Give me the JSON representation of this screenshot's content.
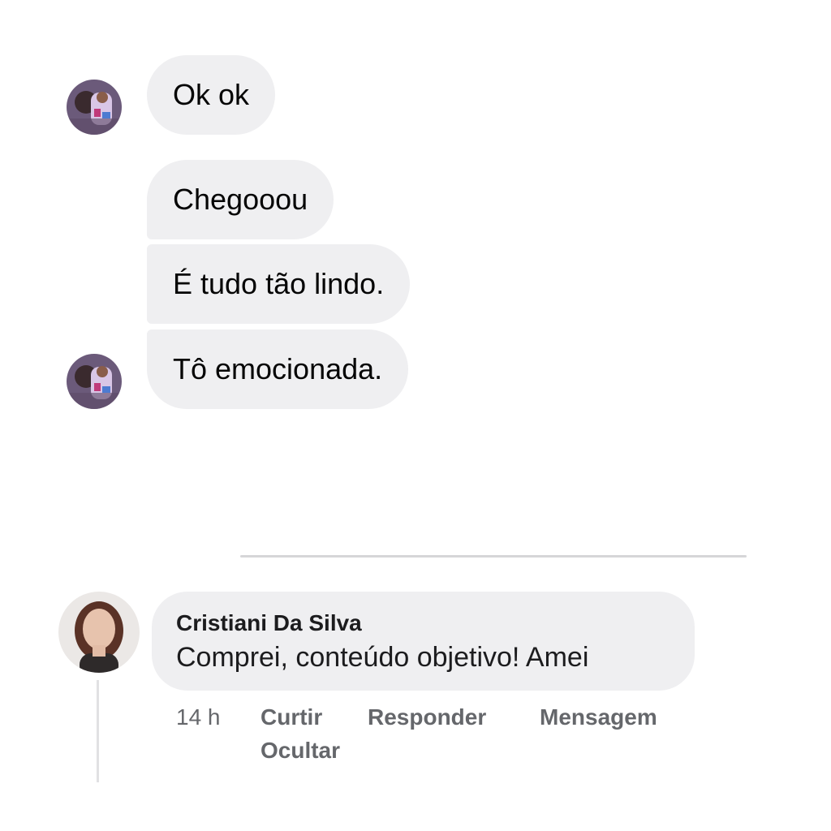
{
  "messages": [
    {
      "text": "Ok ok"
    },
    {
      "text": "Chegooou"
    },
    {
      "text": "É tudo tão lindo."
    },
    {
      "text": "Tô emocionada."
    }
  ],
  "comment": {
    "author": "Cristiani Da Silva",
    "text": "Comprei, conteúdo objetivo! Amei",
    "time": "14 h",
    "actions": {
      "like": "Curtir",
      "reply": "Responder",
      "message": "Mensagem",
      "hide": "Ocultar"
    }
  },
  "colors": {
    "bubble": "#efeff1",
    "action_text": "#65676b",
    "divider": "#d6d6d8"
  }
}
